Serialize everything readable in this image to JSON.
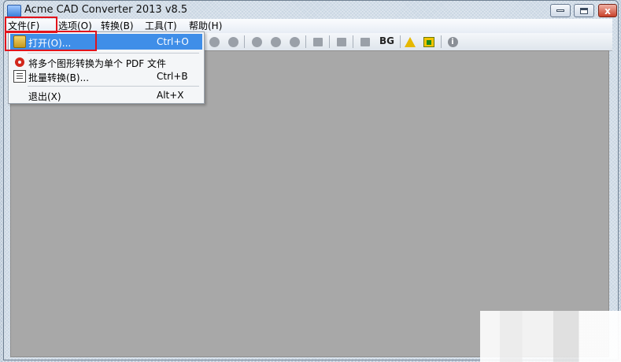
{
  "window": {
    "title": "Acme CAD Converter 2013 v8.5",
    "minimize_symbol": "",
    "maximize_symbol": "",
    "close_symbol": "x"
  },
  "menubar": {
    "file": "文件(F)",
    "options": "选项(O)",
    "convert": "转换(B)",
    "tools": "工具(T)",
    "help": "帮助(H)"
  },
  "toolbar": {
    "bg_label": "BG",
    "icons": [
      "zoom-out-icon",
      "zoom-window-icon",
      "zoom-in-icon",
      "zoom-extents-icon",
      "view-icon",
      "layer-icon",
      "layout-icon",
      "frame-icon",
      "bg-color-icon",
      "warning-icon",
      "home-icon",
      "info-icon"
    ]
  },
  "file_menu": {
    "items": [
      {
        "label": "打开(O)...",
        "shortcut": "Ctrl+O",
        "icon": "folder-open-icon",
        "highlighted": true
      },
      {
        "label": "将多个图形转换为单个 PDF 文件",
        "shortcut": "",
        "icon": "pdf-icon",
        "highlighted": false
      },
      {
        "label": "批量转换(B)...",
        "shortcut": "Ctrl+B",
        "icon": "batch-convert-icon",
        "highlighted": false
      },
      {
        "label": "退出(X)",
        "shortcut": "Alt+X",
        "icon": "",
        "highlighted": false
      }
    ]
  },
  "colors": {
    "highlight": "#3f8ee8",
    "annotation": "#e2141b",
    "workspace": "#a8a8a8"
  }
}
